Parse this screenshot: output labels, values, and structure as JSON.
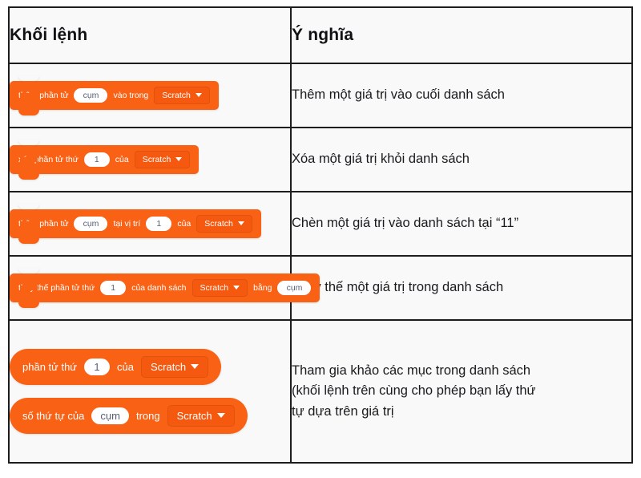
{
  "table": {
    "headers": {
      "blocks": "Khối lệnh",
      "meaning": "Ý nghĩa"
    },
    "rows": [
      {
        "meaning": "Thêm một giá trị vào cuối danh sách",
        "blocks": [
          {
            "kind": "stack",
            "parts": [
              {
                "type": "label",
                "text": "thêm phần tử"
              },
              {
                "type": "text-field",
                "value": "cụm"
              },
              {
                "type": "label",
                "text": "vào trong"
              },
              {
                "type": "dropdown",
                "value": "Scratch",
                "icon": "chevron-down-icon"
              }
            ]
          }
        ]
      },
      {
        "meaning": "Xóa một giá trị khỏi danh sách",
        "blocks": [
          {
            "kind": "stack",
            "parts": [
              {
                "type": "label",
                "text": "xóa phần tử thứ"
              },
              {
                "type": "num-field",
                "value": "1"
              },
              {
                "type": "label",
                "text": "của"
              },
              {
                "type": "dropdown",
                "value": "Scratch",
                "icon": "chevron-down-icon"
              }
            ]
          }
        ]
      },
      {
        "meaning": "Chèn một giá trị vào danh sách tại “11”",
        "blocks": [
          {
            "kind": "stack",
            "parts": [
              {
                "type": "label",
                "text": "thêm phần tử"
              },
              {
                "type": "text-field",
                "value": "cụm"
              },
              {
                "type": "label",
                "text": "tại vị trí"
              },
              {
                "type": "num-field",
                "value": "1"
              },
              {
                "type": "label",
                "text": "của"
              },
              {
                "type": "dropdown",
                "value": "Scratch",
                "icon": "chevron-down-icon"
              }
            ]
          }
        ]
      },
      {
        "meaning": "Thay thế một giá trị trong danh sách",
        "blocks": [
          {
            "kind": "stack",
            "parts": [
              {
                "type": "label",
                "text": "thay thế phần tử thứ"
              },
              {
                "type": "num-field",
                "value": "1"
              },
              {
                "type": "label",
                "text": "của danh sách"
              },
              {
                "type": "dropdown",
                "value": "Scratch",
                "icon": "chevron-down-icon"
              },
              {
                "type": "label",
                "text": "bằng"
              },
              {
                "type": "text-field",
                "value": "cụm"
              }
            ]
          }
        ]
      },
      {
        "meaning": "Tham gia khảo các mục trong danh sách\n(khối lệnh trên cùng cho phép bạn lấy thứ\ntự dựa trên giá trị",
        "blocks": [
          {
            "kind": "reporter",
            "parts": [
              {
                "type": "label",
                "text": "phần tử thứ"
              },
              {
                "type": "num-field",
                "value": "1"
              },
              {
                "type": "label",
                "text": "của"
              },
              {
                "type": "dropdown",
                "value": "Scratch",
                "icon": "chevron-down-icon"
              }
            ]
          },
          {
            "kind": "reporter",
            "parts": [
              {
                "type": "label",
                "text": "số thứ tự của"
              },
              {
                "type": "text-field",
                "value": "cụm"
              },
              {
                "type": "label",
                "text": "trong"
              },
              {
                "type": "dropdown",
                "value": "Scratch",
                "icon": "chevron-down-icon"
              }
            ]
          }
        ]
      }
    ]
  },
  "colors": {
    "block_orange": "#f96115",
    "dropdown_orange": "#f4590f",
    "field_white": "#ffffff",
    "field_text": "#575e75",
    "table_border": "#1d1d1f",
    "cell_background": "#f9f9fa",
    "text": "#1a1a1d"
  }
}
